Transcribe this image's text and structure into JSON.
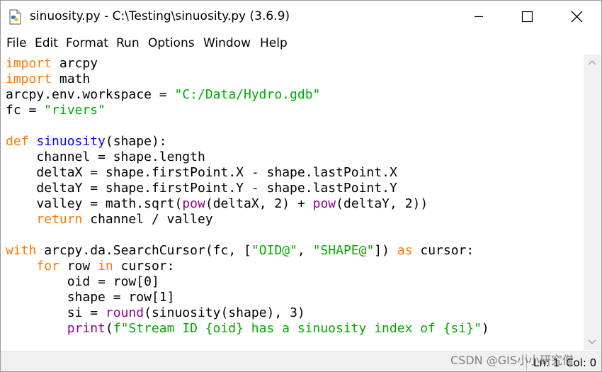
{
  "window": {
    "title": "sinuosity.py - C:\\Testing\\sinuosity.py (3.6.9)",
    "icon": "python-file-icon"
  },
  "menu": {
    "items": [
      "File",
      "Edit",
      "Format",
      "Run",
      "Options",
      "Window",
      "Help"
    ]
  },
  "editor": {
    "language": "python",
    "colors": {
      "keyword": "#ff7700",
      "string": "#00aa00",
      "builtin": "#900090",
      "definition": "#0000ff",
      "default": "#000000"
    },
    "lines": [
      "import arcpy",
      "import math",
      "arcpy.env.workspace = \"C:/Data/Hydro.gdb\"",
      "fc = \"rivers\"",
      "",
      "def sinuosity(shape):",
      "    channel = shape.length",
      "    deltaX = shape.firstPoint.X - shape.lastPoint.X",
      "    deltaY = shape.firstPoint.Y - shape.lastPoint.Y",
      "    valley = math.sqrt(pow(deltaX, 2) + pow(deltaY, 2))",
      "    return channel / valley",
      "",
      "with arcpy.da.SearchCursor(fc, [\"OID@\", \"SHAPE@\"]) as cursor:",
      "    for row in cursor:",
      "        oid = row[0]",
      "        shape = row[1]",
      "        si = round(sinuosity(shape), 3)",
      "        print(f\"Stream ID {oid} has a sinuosity index of {si}\")"
    ]
  },
  "status": {
    "line": "Ln: 1",
    "col": "Col: 0"
  },
  "watermark": "CSDN @GIS小小研究僧"
}
